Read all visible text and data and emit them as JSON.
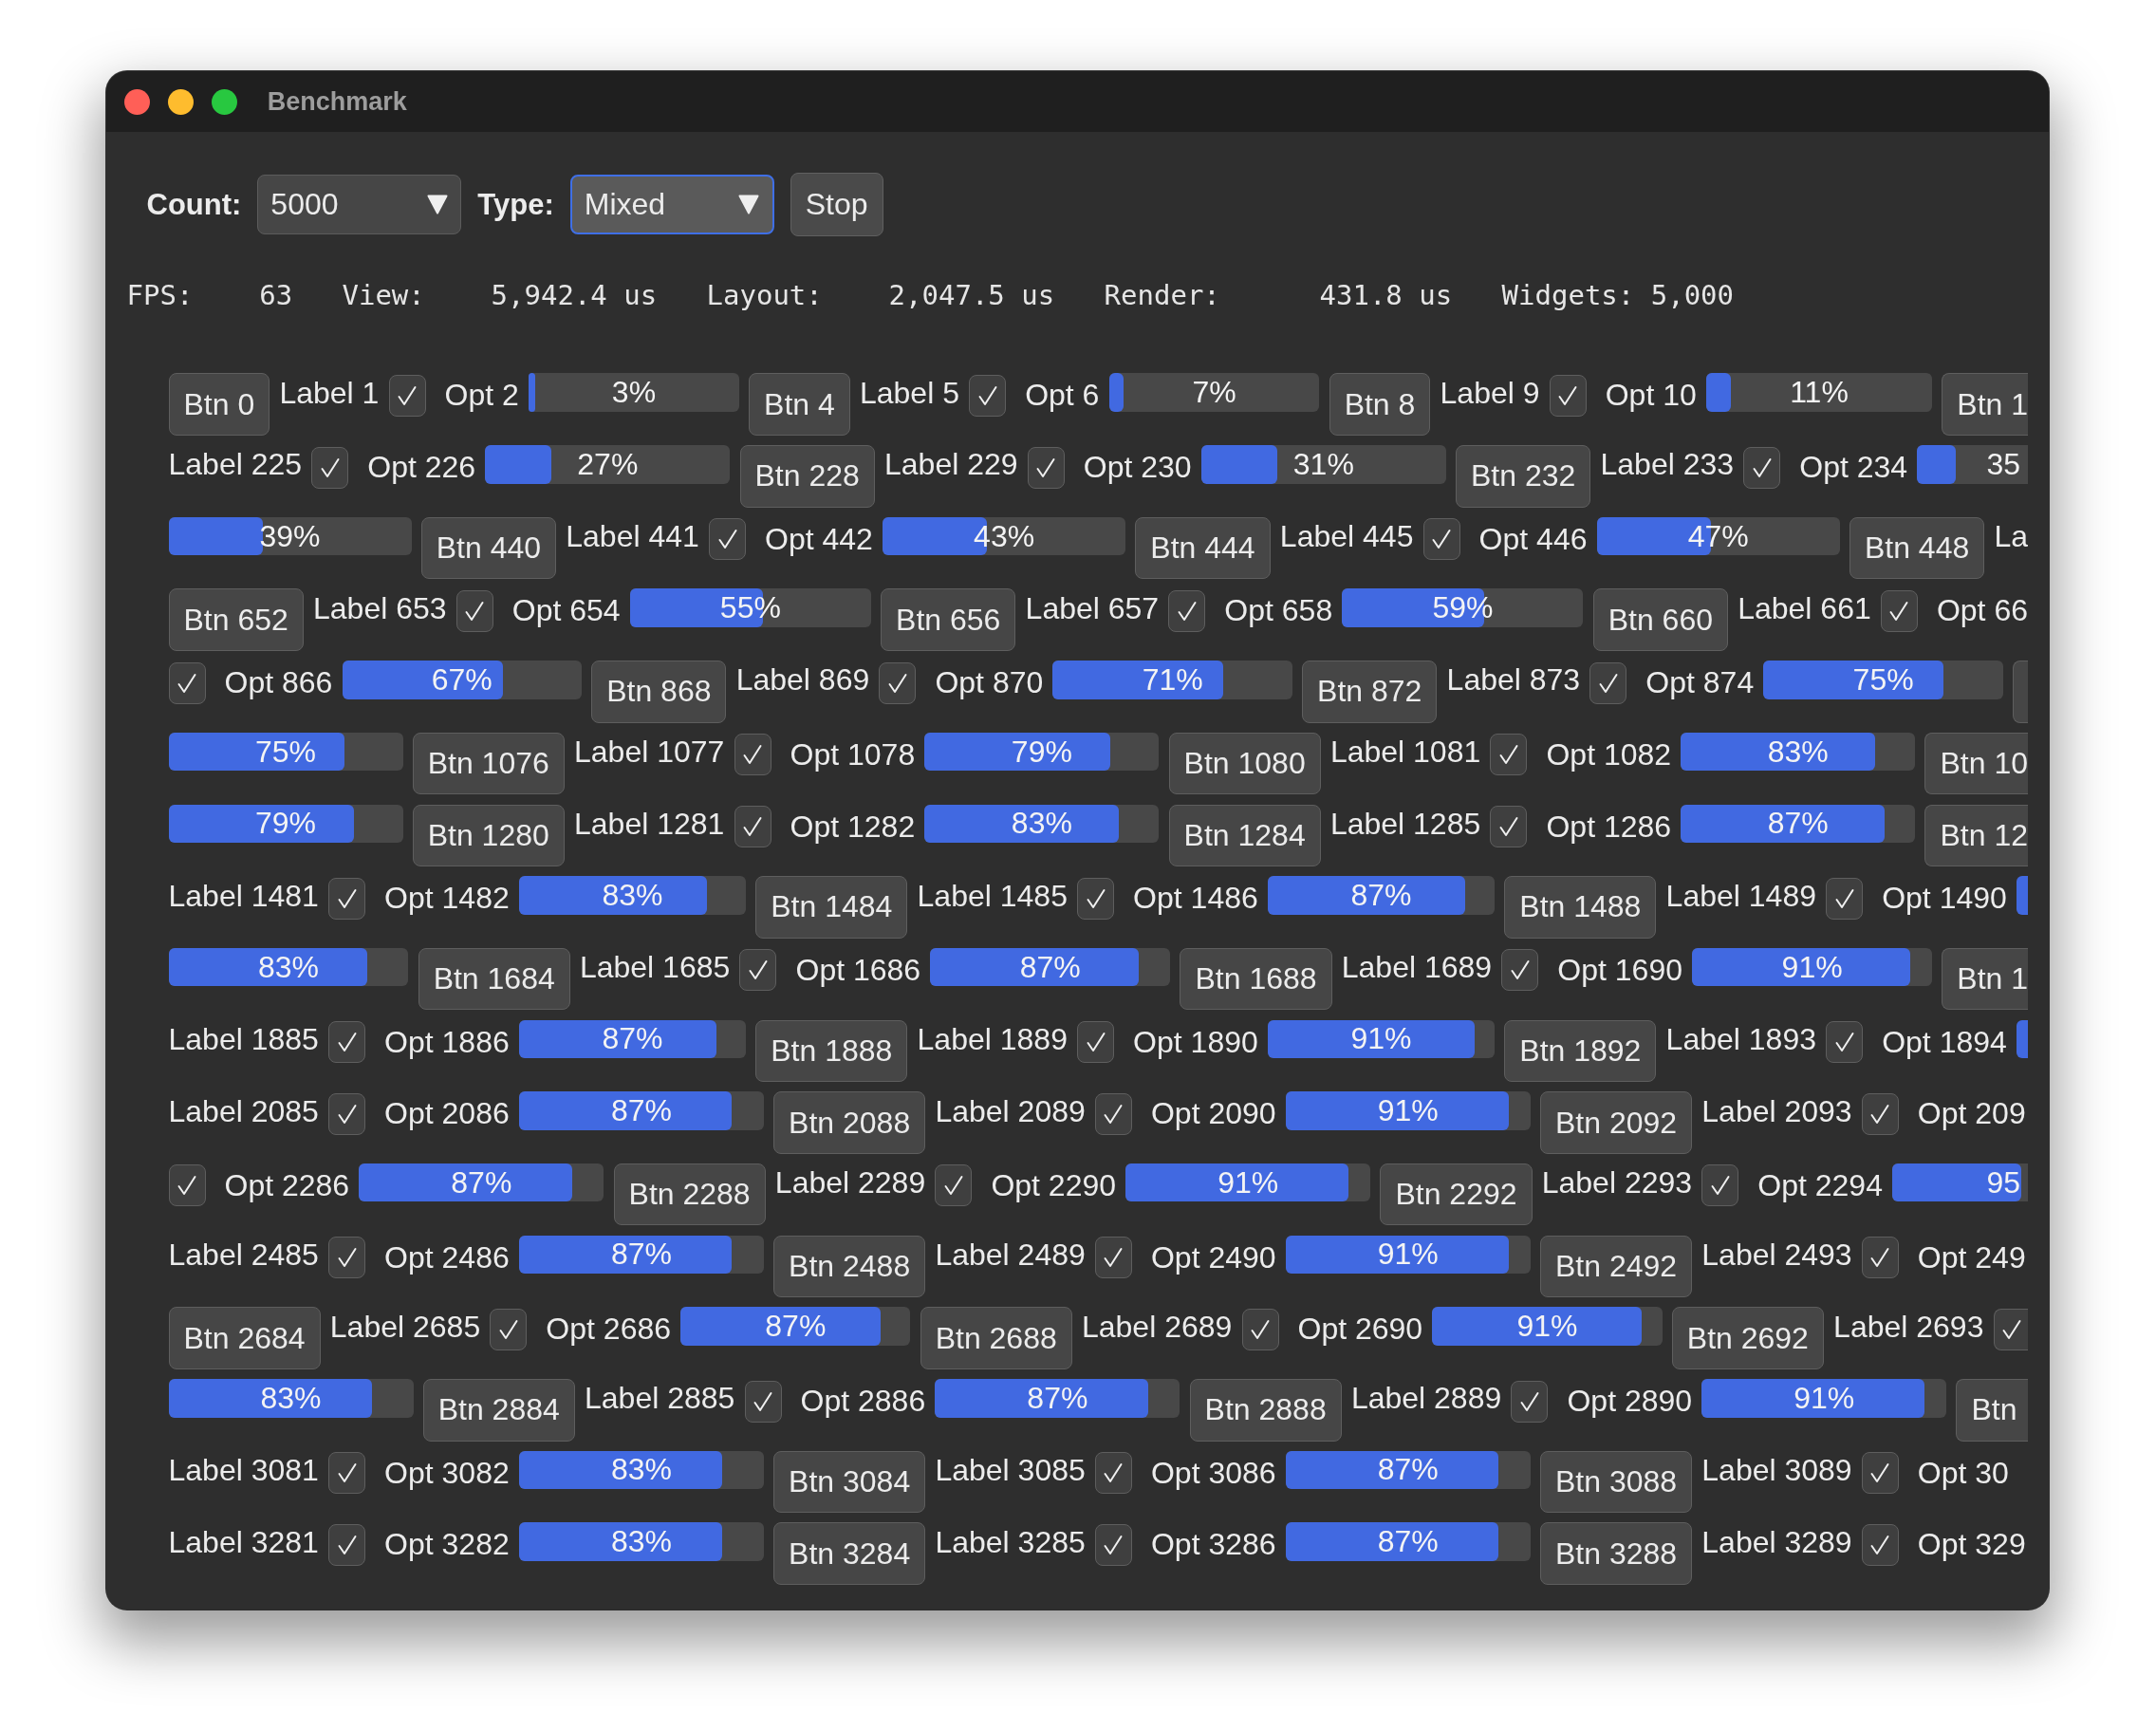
{
  "window": {
    "title": "Benchmark"
  },
  "toolbar": [
    {
      "kind": "dropdown",
      "label": "Count:",
      "value": "5000",
      "focused": false
    },
    {
      "kind": "dropdown",
      "label": "Type:",
      "value": "Mixed",
      "focused": true
    },
    {
      "kind": "button",
      "label": "Stop"
    }
  ],
  "stats": [
    {
      "label": "FPS:",
      "value": "63"
    },
    {
      "label": "View:",
      "value": "5,942.4 us"
    },
    {
      "label": "Layout:",
      "value": "2,047.5 us"
    },
    {
      "label": "Render:",
      "value": "431.8 us"
    },
    {
      "label": "Widgets:",
      "value": "5,000"
    }
  ],
  "grid": {
    "rows": [
      {
        "items": [
          {
            "kind": "button",
            "label": "Btn 0"
          },
          {
            "kind": "label",
            "text": "Label 1"
          },
          {
            "kind": "checkbox",
            "label": "Opt 2",
            "checked": true
          },
          {
            "kind": "progress",
            "level": 0.03,
            "text": "3%"
          },
          {
            "kind": "button",
            "label": "Btn 4"
          },
          {
            "kind": "label",
            "text": "Label 5"
          },
          {
            "kind": "checkbox",
            "label": "Opt 6",
            "checked": true
          },
          {
            "kind": "progress",
            "level": 0.07,
            "text": "7%"
          },
          {
            "kind": "button",
            "label": "Btn 8"
          },
          {
            "kind": "label",
            "text": "Label 9"
          },
          {
            "kind": "checkbox",
            "label": "Opt 10",
            "checked": true
          },
          {
            "kind": "progress",
            "level": 0.11,
            "text": "11%"
          },
          {
            "kind": "button",
            "label": "Btn 1"
          }
        ]
      },
      {
        "items": [
          {
            "kind": "label",
            "text": "Label 225"
          },
          {
            "kind": "checkbox",
            "label": "Opt 226",
            "checked": true
          },
          {
            "kind": "progress",
            "level": 0.27,
            "text": "27%"
          },
          {
            "kind": "button",
            "label": "Btn 228"
          },
          {
            "kind": "label",
            "text": "Label 229"
          },
          {
            "kind": "checkbox",
            "label": "Opt 230",
            "checked": true
          },
          {
            "kind": "progress",
            "level": 0.31,
            "text": "31%"
          },
          {
            "kind": "button",
            "label": "Btn 232"
          },
          {
            "kind": "label",
            "text": "Label 233"
          },
          {
            "kind": "checkbox",
            "label": "Opt 234",
            "checked": true
          },
          {
            "kind": "progress",
            "level": 0.35,
            "text": "35"
          }
        ]
      },
      {
        "items": [
          {
            "kind": "progress",
            "level": 0.39,
            "text": "39%"
          },
          {
            "kind": "button",
            "label": "Btn 440"
          },
          {
            "kind": "label",
            "text": "Label 441"
          },
          {
            "kind": "checkbox",
            "label": "Opt 442",
            "checked": true
          },
          {
            "kind": "progress",
            "level": 0.43,
            "text": "43%"
          },
          {
            "kind": "button",
            "label": "Btn 444"
          },
          {
            "kind": "label",
            "text": "Label 445"
          },
          {
            "kind": "checkbox",
            "label": "Opt 446",
            "checked": true
          },
          {
            "kind": "progress",
            "level": 0.47,
            "text": "47%"
          },
          {
            "kind": "button",
            "label": "Btn 448"
          },
          {
            "kind": "label",
            "text": "La"
          }
        ]
      },
      {
        "items": [
          {
            "kind": "button",
            "label": "Btn 652"
          },
          {
            "kind": "label",
            "text": "Label 653"
          },
          {
            "kind": "checkbox",
            "label": "Opt 654",
            "checked": true
          },
          {
            "kind": "progress",
            "level": 0.55,
            "text": "55%"
          },
          {
            "kind": "button",
            "label": "Btn 656"
          },
          {
            "kind": "label",
            "text": "Label 657"
          },
          {
            "kind": "checkbox",
            "label": "Opt 658",
            "checked": true
          },
          {
            "kind": "progress",
            "level": 0.59,
            "text": "59%"
          },
          {
            "kind": "button",
            "label": "Btn 660"
          },
          {
            "kind": "label",
            "text": "Label 661"
          },
          {
            "kind": "checkbox",
            "label": "Opt 66",
            "checked": true
          }
        ]
      },
      {
        "items": [
          {
            "kind": "checkbox",
            "label": "Opt 866",
            "checked": true
          },
          {
            "kind": "progress",
            "level": 0.67,
            "text": "67%"
          },
          {
            "kind": "button",
            "label": "Btn 868"
          },
          {
            "kind": "label",
            "text": "Label 869"
          },
          {
            "kind": "checkbox",
            "label": "Opt 870",
            "checked": true
          },
          {
            "kind": "progress",
            "level": 0.71,
            "text": "71%"
          },
          {
            "kind": "button",
            "label": "Btn 872"
          },
          {
            "kind": "label",
            "text": "Label 873"
          },
          {
            "kind": "checkbox",
            "label": "Opt 874",
            "checked": true
          },
          {
            "kind": "progress",
            "level": 0.75,
            "text": "75%"
          },
          {
            "kind": "button"
          }
        ]
      },
      {
        "items": [
          {
            "kind": "progress",
            "level": 0.75,
            "text": "75%"
          },
          {
            "kind": "button",
            "label": "Btn 1076"
          },
          {
            "kind": "label",
            "text": "Label 1077"
          },
          {
            "kind": "checkbox",
            "label": "Opt 1078",
            "checked": true
          },
          {
            "kind": "progress",
            "level": 0.79,
            "text": "79%"
          },
          {
            "kind": "button",
            "label": "Btn 1080"
          },
          {
            "kind": "label",
            "text": "Label 1081"
          },
          {
            "kind": "checkbox",
            "label": "Opt 1082",
            "checked": true
          },
          {
            "kind": "progress",
            "level": 0.83,
            "text": "83%"
          },
          {
            "kind": "button",
            "label": "Btn 10"
          }
        ]
      },
      {
        "items": [
          {
            "kind": "progress",
            "level": 0.79,
            "text": "79%"
          },
          {
            "kind": "button",
            "label": "Btn 1280"
          },
          {
            "kind": "label",
            "text": "Label 1281"
          },
          {
            "kind": "checkbox",
            "label": "Opt 1282",
            "checked": true
          },
          {
            "kind": "progress",
            "level": 0.83,
            "text": "83%"
          },
          {
            "kind": "button",
            "label": "Btn 1284"
          },
          {
            "kind": "label",
            "text": "Label 1285"
          },
          {
            "kind": "checkbox",
            "label": "Opt 1286",
            "checked": true
          },
          {
            "kind": "progress",
            "level": 0.87,
            "text": "87%"
          },
          {
            "kind": "button",
            "label": "Btn 12"
          }
        ]
      },
      {
        "items": [
          {
            "kind": "label",
            "text": "Label 1481"
          },
          {
            "kind": "checkbox",
            "label": "Opt 1482",
            "checked": true
          },
          {
            "kind": "progress",
            "level": 0.83,
            "text": "83%"
          },
          {
            "kind": "button",
            "label": "Btn 1484"
          },
          {
            "kind": "label",
            "text": "Label 1485"
          },
          {
            "kind": "checkbox",
            "label": "Opt 1486",
            "checked": true
          },
          {
            "kind": "progress",
            "level": 0.87,
            "text": "87%"
          },
          {
            "kind": "button",
            "label": "Btn 1488"
          },
          {
            "kind": "label",
            "text": "Label 1489"
          },
          {
            "kind": "checkbox",
            "label": "Opt 1490",
            "checked": true
          },
          {
            "kind": "progress",
            "level": 1
          }
        ]
      },
      {
        "items": [
          {
            "kind": "progress",
            "level": 0.83,
            "text": "83%"
          },
          {
            "kind": "button",
            "label": "Btn 1684"
          },
          {
            "kind": "label",
            "text": "Label 1685"
          },
          {
            "kind": "checkbox",
            "label": "Opt 1686",
            "checked": true
          },
          {
            "kind": "progress",
            "level": 0.87,
            "text": "87%"
          },
          {
            "kind": "button",
            "label": "Btn 1688"
          },
          {
            "kind": "label",
            "text": "Label 1689"
          },
          {
            "kind": "checkbox",
            "label": "Opt 1690",
            "checked": true
          },
          {
            "kind": "progress",
            "level": 0.91,
            "text": "91%"
          },
          {
            "kind": "button",
            "label": "Btn 1"
          }
        ]
      },
      {
        "items": [
          {
            "kind": "label",
            "text": "Label 1885"
          },
          {
            "kind": "checkbox",
            "label": "Opt 1886",
            "checked": true
          },
          {
            "kind": "progress",
            "level": 0.87,
            "text": "87%"
          },
          {
            "kind": "button",
            "label": "Btn 1888"
          },
          {
            "kind": "label",
            "text": "Label 1889"
          },
          {
            "kind": "checkbox",
            "label": "Opt 1890",
            "checked": true
          },
          {
            "kind": "progress",
            "level": 0.91,
            "text": "91%"
          },
          {
            "kind": "button",
            "label": "Btn 1892"
          },
          {
            "kind": "label",
            "text": "Label 1893"
          },
          {
            "kind": "checkbox",
            "label": "Opt 1894",
            "checked": true
          },
          {
            "kind": "progress",
            "level": 1
          }
        ]
      },
      {
        "items": [
          {
            "kind": "label",
            "text": "Label 2085"
          },
          {
            "kind": "checkbox",
            "label": "Opt 2086",
            "checked": true
          },
          {
            "kind": "progress",
            "level": 0.87,
            "text": "87%"
          },
          {
            "kind": "button",
            "label": "Btn 2088"
          },
          {
            "kind": "label",
            "text": "Label 2089"
          },
          {
            "kind": "checkbox",
            "label": "Opt 2090",
            "checked": true
          },
          {
            "kind": "progress",
            "level": 0.91,
            "text": "91%"
          },
          {
            "kind": "button",
            "label": "Btn 2092"
          },
          {
            "kind": "label",
            "text": "Label 2093"
          },
          {
            "kind": "checkbox",
            "label": "Opt 209",
            "checked": true
          }
        ]
      },
      {
        "items": [
          {
            "kind": "checkbox",
            "label": "Opt 2286",
            "checked": true
          },
          {
            "kind": "progress",
            "level": 0.87,
            "text": "87%"
          },
          {
            "kind": "button",
            "label": "Btn 2288"
          },
          {
            "kind": "label",
            "text": "Label 2289"
          },
          {
            "kind": "checkbox",
            "label": "Opt 2290",
            "checked": true
          },
          {
            "kind": "progress",
            "level": 0.91,
            "text": "91%"
          },
          {
            "kind": "button",
            "label": "Btn 2292"
          },
          {
            "kind": "label",
            "text": "Label 2293"
          },
          {
            "kind": "checkbox",
            "label": "Opt 2294",
            "checked": true
          },
          {
            "kind": "progress",
            "level": 0.95,
            "text": "95"
          }
        ]
      },
      {
        "items": [
          {
            "kind": "label",
            "text": "Label 2485"
          },
          {
            "kind": "checkbox",
            "label": "Opt 2486",
            "checked": true
          },
          {
            "kind": "progress",
            "level": 0.87,
            "text": "87%"
          },
          {
            "kind": "button",
            "label": "Btn 2488"
          },
          {
            "kind": "label",
            "text": "Label 2489"
          },
          {
            "kind": "checkbox",
            "label": "Opt 2490",
            "checked": true
          },
          {
            "kind": "progress",
            "level": 0.91,
            "text": "91%"
          },
          {
            "kind": "button",
            "label": "Btn 2492"
          },
          {
            "kind": "label",
            "text": "Label 2493"
          },
          {
            "kind": "checkbox",
            "label": "Opt 249",
            "checked": true
          }
        ]
      },
      {
        "items": [
          {
            "kind": "button",
            "label": "Btn 2684"
          },
          {
            "kind": "label",
            "text": "Label 2685"
          },
          {
            "kind": "checkbox",
            "label": "Opt 2686",
            "checked": true
          },
          {
            "kind": "progress",
            "level": 0.87,
            "text": "87%"
          },
          {
            "kind": "button",
            "label": "Btn 2688"
          },
          {
            "kind": "label",
            "text": "Label 2689"
          },
          {
            "kind": "checkbox",
            "label": "Opt 2690",
            "checked": true
          },
          {
            "kind": "progress",
            "level": 0.91,
            "text": "91%"
          },
          {
            "kind": "button",
            "label": "Btn 2692"
          },
          {
            "kind": "label",
            "text": "Label 2693"
          },
          {
            "kind": "checkbox",
            "checked": true
          }
        ]
      },
      {
        "items": [
          {
            "kind": "progress",
            "level": 0.83,
            "text": "83%"
          },
          {
            "kind": "button",
            "label": "Btn 2884"
          },
          {
            "kind": "label",
            "text": "Label 2885"
          },
          {
            "kind": "checkbox",
            "label": "Opt 2886",
            "checked": true
          },
          {
            "kind": "progress",
            "level": 0.87,
            "text": "87%"
          },
          {
            "kind": "button",
            "label": "Btn 2888"
          },
          {
            "kind": "label",
            "text": "Label 2889"
          },
          {
            "kind": "checkbox",
            "label": "Opt 2890",
            "checked": true
          },
          {
            "kind": "progress",
            "level": 0.91,
            "text": "91%"
          },
          {
            "kind": "button",
            "label": "Btn"
          }
        ]
      },
      {
        "items": [
          {
            "kind": "label",
            "text": "Label 3081"
          },
          {
            "kind": "checkbox",
            "label": "Opt 3082",
            "checked": true
          },
          {
            "kind": "progress",
            "level": 0.83,
            "text": "83%"
          },
          {
            "kind": "button",
            "label": "Btn 3084"
          },
          {
            "kind": "label",
            "text": "Label 3085"
          },
          {
            "kind": "checkbox",
            "label": "Opt 3086",
            "checked": true
          },
          {
            "kind": "progress",
            "level": 0.87,
            "text": "87%"
          },
          {
            "kind": "button",
            "label": "Btn 3088"
          },
          {
            "kind": "label",
            "text": "Label 3089"
          },
          {
            "kind": "checkbox",
            "label": "Opt 30",
            "checked": true
          }
        ]
      },
      {
        "items": [
          {
            "kind": "label",
            "text": "Label 3281"
          },
          {
            "kind": "checkbox",
            "label": "Opt 3282",
            "checked": true
          },
          {
            "kind": "progress",
            "level": 0.83,
            "text": "83%"
          },
          {
            "kind": "button",
            "label": "Btn 3284"
          },
          {
            "kind": "label",
            "text": "Label 3285"
          },
          {
            "kind": "checkbox",
            "label": "Opt 3286",
            "checked": true
          },
          {
            "kind": "progress",
            "level": 0.87,
            "text": "87%"
          },
          {
            "kind": "button",
            "label": "Btn 3288"
          },
          {
            "kind": "label",
            "text": "Label 3289"
          },
          {
            "kind": "checkbox",
            "label": "Opt 329",
            "checked": true
          }
        ]
      }
    ]
  }
}
